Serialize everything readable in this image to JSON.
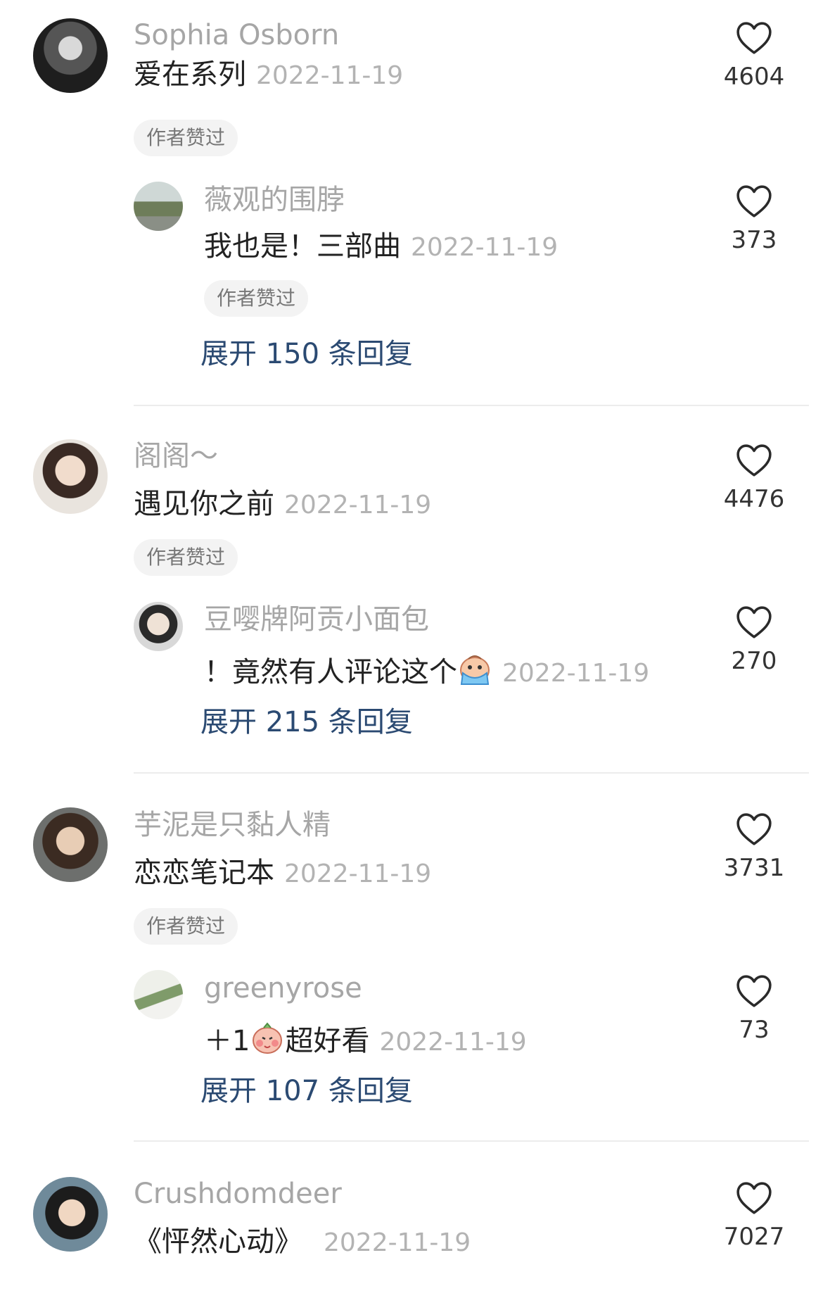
{
  "threads": [
    {
      "comment": {
        "name": "Sophia Osborn",
        "text": "爱在系列",
        "date": "2022-11-19",
        "badge": "作者赞过",
        "likes": "4604"
      },
      "reply": {
        "name": "薇观的围脖",
        "text": "我也是！三部曲",
        "date": "2022-11-19",
        "badge": "作者赞过",
        "likes": "373"
      },
      "expand": "展开 150 条回复"
    },
    {
      "comment": {
        "name": "阁阁～",
        "text": "遇见你之前",
        "date": "2022-11-19",
        "badge": "作者赞过",
        "likes": "4476"
      },
      "reply": {
        "name": "豆嘤牌阿贡小面包",
        "text": "！竟然有人评论这个",
        "date": "2022-11-19",
        "likes": "270"
      },
      "expand": "展开 215 条回复"
    },
    {
      "comment": {
        "name": "芋泥是只黏人精",
        "text": "恋恋笔记本",
        "date": "2022-11-19",
        "badge": "作者赞过",
        "likes": "3731"
      },
      "reply": {
        "name": "greenyrose",
        "text_before": "＋1",
        "text_after": "超好看",
        "date": "2022-11-19",
        "likes": "73"
      },
      "expand": "展开 107 条回复"
    },
    {
      "comment": {
        "name": "Crushdomdeer",
        "text": "《怦然心动》",
        "date": "2022-11-19",
        "likes": "7027"
      }
    }
  ],
  "colors": {
    "name": "#a6a6a6",
    "date": "#b3b3b3",
    "expand": "#2b4a72",
    "heart": "#2a2a2a"
  },
  "icons": [
    "heart-outline-icon",
    "crying-emoji-icon",
    "blushing-emoji-icon"
  ]
}
